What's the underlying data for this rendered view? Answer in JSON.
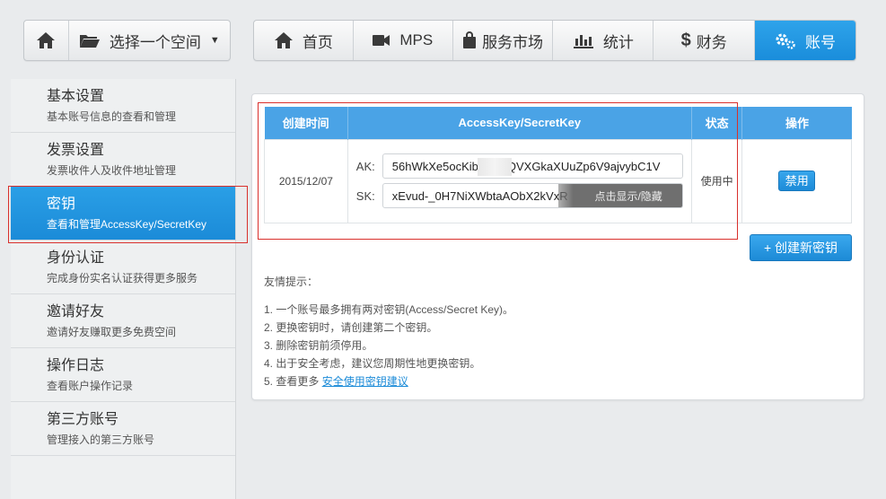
{
  "nav": {
    "space_selector": "选择一个空间",
    "items": [
      {
        "label": "首页",
        "icon": "home-icon"
      },
      {
        "label": "MPS",
        "icon": "video-camera-icon"
      },
      {
        "label": "服务市场",
        "icon": "shopping-bag-icon"
      },
      {
        "label": "统计",
        "icon": "bar-chart-icon"
      },
      {
        "label": "财务",
        "icon": "dollar-icon"
      },
      {
        "label": "账号",
        "icon": "gears-icon",
        "active": true
      }
    ]
  },
  "sidebar": {
    "items": [
      {
        "title": "基本设置",
        "subtitle": "基本账号信息的查看和管理"
      },
      {
        "title": "发票设置",
        "subtitle": "发票收件人及收件地址管理"
      },
      {
        "title": "密钥",
        "subtitle": "查看和管理AccessKey/SecretKey",
        "active": true
      },
      {
        "title": "身份认证",
        "subtitle": "完成身份实名认证获得更多服务"
      },
      {
        "title": "邀请好友",
        "subtitle": "邀请好友赚取更多免费空间"
      },
      {
        "title": "操作日志",
        "subtitle": "查看账户操作记录"
      },
      {
        "title": "第三方账号",
        "subtitle": "管理接入的第三方账号"
      }
    ]
  },
  "table": {
    "headers": [
      "创建时间",
      "AccessKey/SecretKey",
      "状态",
      "操作"
    ],
    "rows": [
      {
        "created": "2015/12/07",
        "ak_label": "AK:",
        "ak_prefix": "56hWkXe5ocKibZ",
        "ak_suffix": "QVXGkaXUuZp6V9ajvybC1V",
        "sk_label": "SK:",
        "sk_value": "xEvud-_0H7NiXWbtaAObX2kVxR",
        "show_hide": "点击显示/隐藏",
        "status": "使用中",
        "action": "禁用"
      }
    ]
  },
  "create_button": "+ 创建新密钥",
  "tips": {
    "title": "友情提示：",
    "items": [
      "1. 一个账号最多拥有两对密钥(Access/Secret Key)。",
      "2. 更换密钥时，请创建第二个密钥。",
      "3. 删除密钥前须停用。",
      "4. 出于安全考虑，建议您周期性地更换密钥。",
      "5. 查看更多 "
    ],
    "link": "安全使用密钥建议"
  },
  "colors": {
    "accent": "#1b8bd8",
    "header_blue": "#4aa3e6",
    "status_green": "#4a9d3a",
    "highlight_red": "#d9302c"
  }
}
